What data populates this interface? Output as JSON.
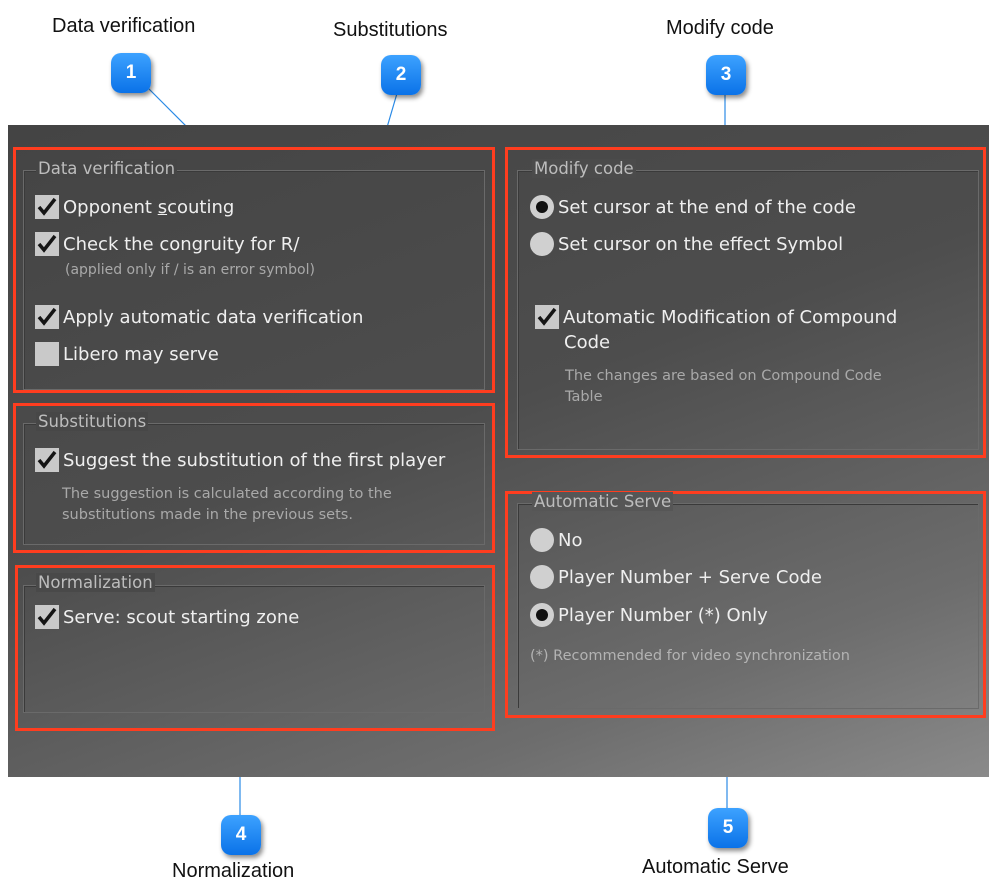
{
  "callouts": [
    {
      "number": "1",
      "title": "Data verification"
    },
    {
      "number": "2",
      "title": "Substitutions"
    },
    {
      "number": "3",
      "title": "Modify code"
    },
    {
      "number": "4",
      "title": "Normalization"
    },
    {
      "number": "5",
      "title": "Automatic Serve"
    }
  ],
  "data_verification": {
    "title": "Data verification",
    "opponent_scouting": {
      "label_pre": "Opponent ",
      "label_underline": "s",
      "label_post": "couting",
      "checked": true
    },
    "congruity": {
      "label": "Check the congruity for R/",
      "checked": true,
      "note": "(applied only if / is an error symbol)"
    },
    "auto_verification": {
      "label": "Apply automatic data verification",
      "checked": true
    },
    "libero_serve": {
      "label": "Libero may serve",
      "checked": false
    }
  },
  "substitutions": {
    "title": "Substitutions",
    "suggest": {
      "label": "Suggest the substitution of the first player",
      "checked": true
    },
    "note_line1": "The suggestion is calculated according to the",
    "note_line2": "substitutions made in the previous sets."
  },
  "normalization": {
    "title": "Normalization",
    "serve_zone": {
      "label": "Serve: scout starting zone",
      "checked": true
    }
  },
  "modify_code": {
    "title": "Modify code",
    "cursor_end": {
      "label": "Set cursor at the end of the code",
      "selected": true
    },
    "cursor_effect": {
      "label": "Set cursor on the effect Symbol",
      "selected": false
    },
    "auto_modification": {
      "label_line1": "Automatic Modification of Compound",
      "label_line2": "Code",
      "checked": true
    },
    "note_line1": "The changes are based on Compound Code",
    "note_line2": "Table"
  },
  "automatic_serve": {
    "title": "Automatic Serve",
    "options": [
      {
        "label": "No",
        "selected": false
      },
      {
        "label": "Player Number + Serve Code",
        "selected": false
      },
      {
        "label": "Player Number (*) Only",
        "selected": true
      }
    ],
    "note": "(*) Recommended for video synchronization"
  },
  "colors": {
    "highlight_border": "#ff3d1f",
    "callout_blue": "#1f8cff",
    "panel_bg": "#4a4a4a",
    "leader_line": "#2a8ae6"
  }
}
